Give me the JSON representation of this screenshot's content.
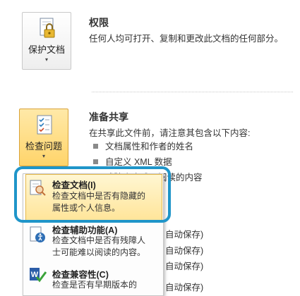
{
  "permissions": {
    "title": "权限",
    "description": "任何人均可打开、复制和更改此文档的任何部分。",
    "button_label": "保护文档",
    "button_caret": "▾"
  },
  "prepare": {
    "title": "准备共享",
    "description": "在共享此文件前，请注意其包含以下内容:",
    "items": [
      "文档属性和作者的姓名",
      "自定义 XML 数据",
      "残障人士难以阅读的内容"
    ],
    "button_label": "检查问题",
    "button_caret": "▾"
  },
  "background_fragments": [
    "自动保存)",
    "自动保存)",
    "自动保存)",
    "自动保存)"
  ],
  "menu": {
    "items": [
      {
        "title": "检查文档(I)",
        "desc_lines": [
          "检查文档中是否有隐藏的",
          "属性或个人信息。"
        ],
        "icon": "inspect-document-icon"
      },
      {
        "title": "检查辅助功能(A)",
        "desc_lines": [
          "检查文档中是否有残障人",
          "士可能难以阅读的内容。"
        ],
        "icon": "accessibility-icon"
      },
      {
        "title": "检查兼容性(C)",
        "desc_lines": [
          "检查是否有早期版本的"
        ],
        "icon": "compatibility-icon"
      }
    ]
  },
  "colors": {
    "callout": "#1f95c9",
    "highlight": "#ffe59a"
  }
}
